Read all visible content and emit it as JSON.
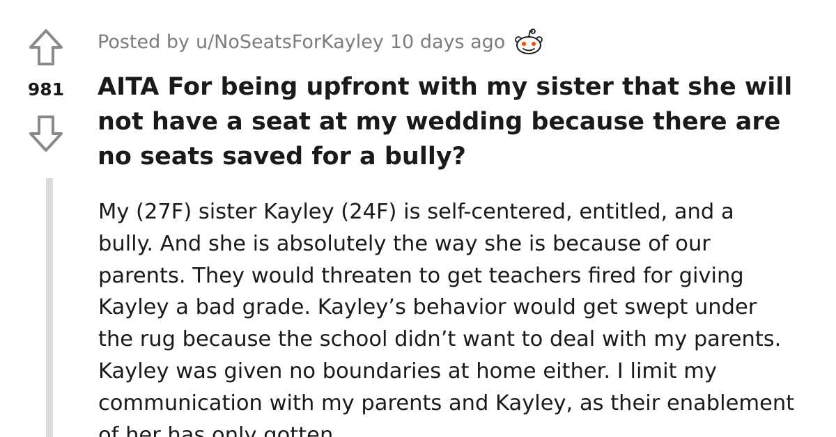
{
  "vote": {
    "score": "981",
    "upvote_icon": "upvote-arrow-icon",
    "downvote_icon": "downvote-arrow-icon"
  },
  "meta": {
    "posted_by_label": "Posted by",
    "author": "u/NoSeatsForKayley",
    "age": "10 days ago",
    "award_icon": "snoo-award-icon"
  },
  "post": {
    "title": "AITA For being upfront with my sister that she will not have a seat at my wedding because there are no seats saved for a bully?",
    "body": "My (27F) sister Kayley (24F) is self-centered, entitled, and a bully. And she is absolutely the way she is because of our parents. They would threaten to get teachers fired for giving Kayley a bad grade. Kayley’s behavior would get swept under the rug because the school didn’t want to deal with my parents. Kayley was given no boundaries at home either. I limit my communication with my parents and Kayley, as their enablement of her has only gotten"
  },
  "colors": {
    "text": "#1a1a1b",
    "meta_text": "#7c7c7c",
    "vote_arrow": "#878a8c",
    "rail": "#dcdcdc"
  }
}
